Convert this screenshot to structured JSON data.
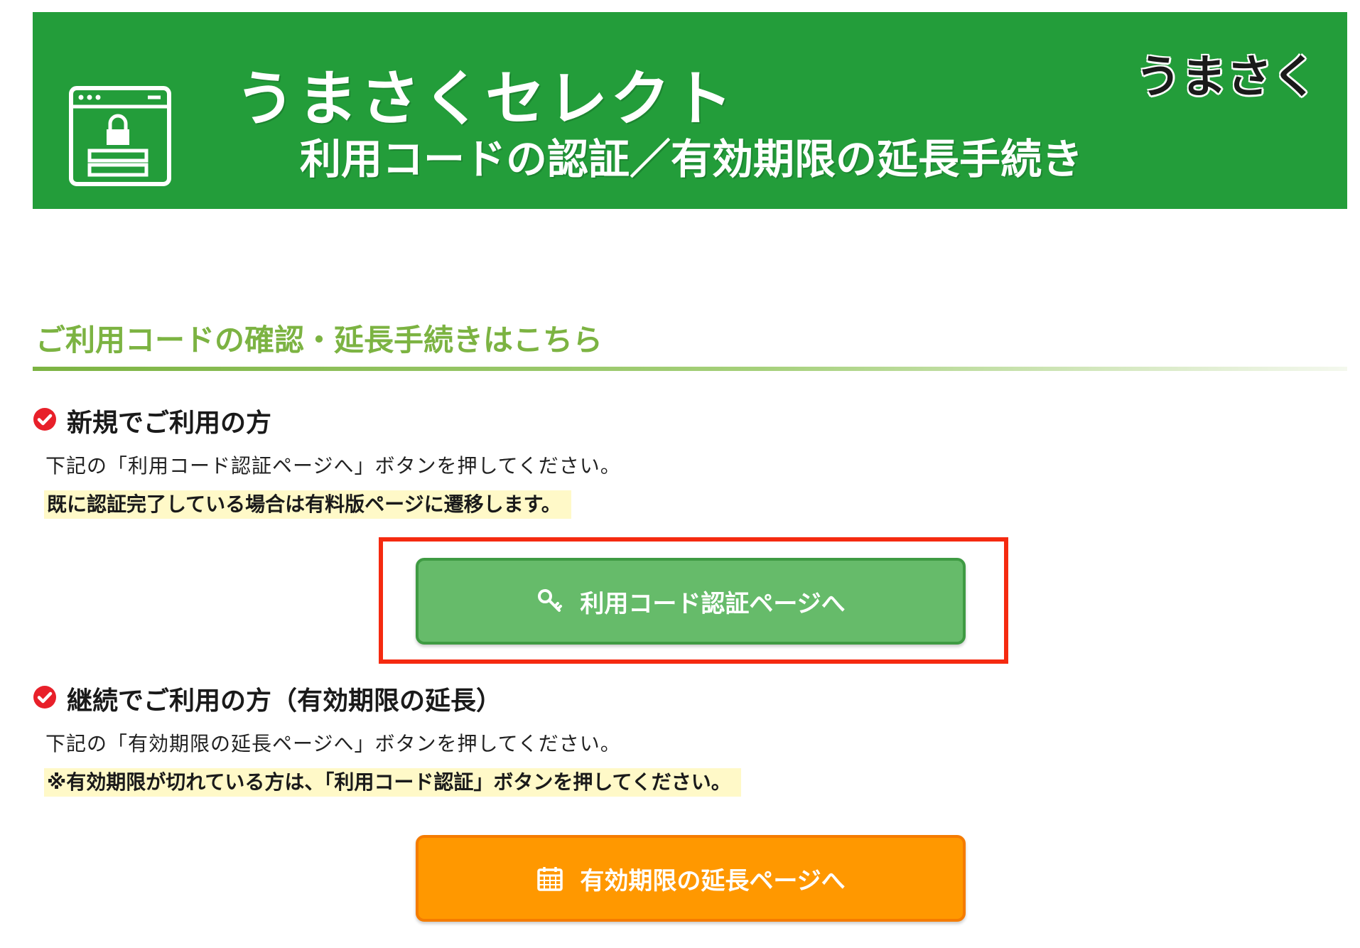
{
  "banner": {
    "title": "うまさくセレクト",
    "subtitle": "利用コードの認証／有効期限の延長手続き",
    "brand": "うまさく",
    "background_color": "#239d3a",
    "icon": "locked-browser-window-icon"
  },
  "section": {
    "heading": "ご利用コードの確認・延長手続きはこちら",
    "accent_color": "#7cb342"
  },
  "new_users": {
    "heading": "新規でご利用の方",
    "instruction": "下記の「利用コード認証ページへ」ボタンを押してください。",
    "note": "既に認証完了している場合は有料版ページに遷移します。",
    "button_label": "利用コード認証ページへ",
    "button_icon": "key-icon",
    "button_color": "#66bb6a"
  },
  "continuing_users": {
    "heading": "継続でご利用の方（有効期限の延長）",
    "instruction": "下記の「有効期限の延長ページへ」ボタンを押してください。",
    "note": "※有効期限が切れている方は、「利用コード認証」ボタンを押してください。",
    "button_label": "有効期限の延長ページへ",
    "button_icon": "calendar-icon",
    "button_color": "#ff9800"
  },
  "highlight_color": "#f52a10"
}
